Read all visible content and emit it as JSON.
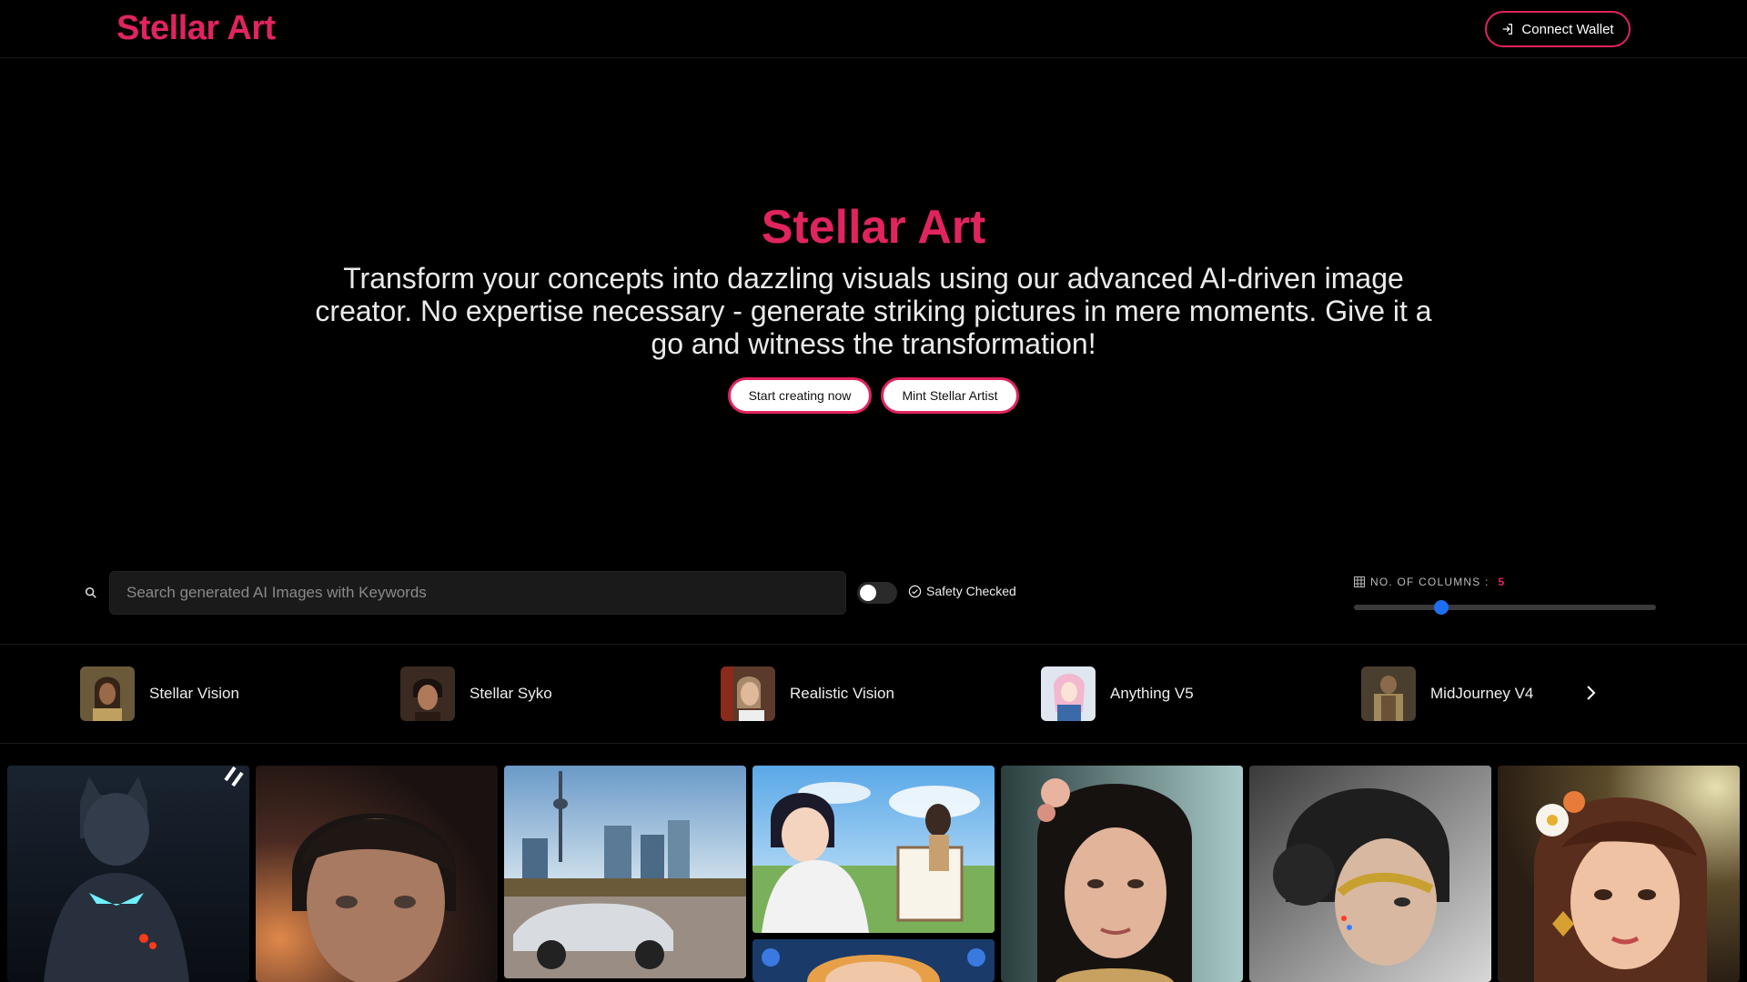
{
  "header": {
    "logo": "Stellar Art",
    "connect_label": "Connect Wallet"
  },
  "hero": {
    "title": "Stellar Art",
    "description": "Transform your concepts into dazzling visuals using our advanced AI-driven image creator. No expertise necessary - generate striking pictures in mere moments. Give it a go and witness the transformation!",
    "primary_label": "Start creating now",
    "secondary_label": "Mint Stellar Artist"
  },
  "search": {
    "placeholder": "Search generated AI Images with Keywords",
    "value": ""
  },
  "safety": {
    "label": "Safety Checked",
    "enabled": false
  },
  "columns": {
    "label": "NO. OF COLUMNS :",
    "value": "5",
    "slider_fraction": 0.29
  },
  "models": [
    {
      "name": "Stellar Vision"
    },
    {
      "name": "Stellar Syko"
    },
    {
      "name": "Realistic Vision"
    },
    {
      "name": "Anything V5"
    },
    {
      "name": "MidJourney V4"
    }
  ],
  "gallery": [
    {
      "name": "batman-armor-image"
    },
    {
      "name": "child-portrait-image"
    },
    {
      "name": "city-car-image"
    },
    {
      "name": "anime-painting-image"
    },
    {
      "name": "anime-figure-image"
    },
    {
      "name": "woman-portrait-image"
    },
    {
      "name": "robot-woman-image"
    },
    {
      "name": "flower-girl-image"
    }
  ],
  "colors": {
    "accent": "#e0245e",
    "slider_thumb": "#1d6ff2",
    "background": "#000000"
  },
  "icons": {
    "connect": "login-icon",
    "search": "search-icon",
    "safety": "check-circle-icon",
    "columns": "grid-icon",
    "next": "chevron-right-icon"
  }
}
